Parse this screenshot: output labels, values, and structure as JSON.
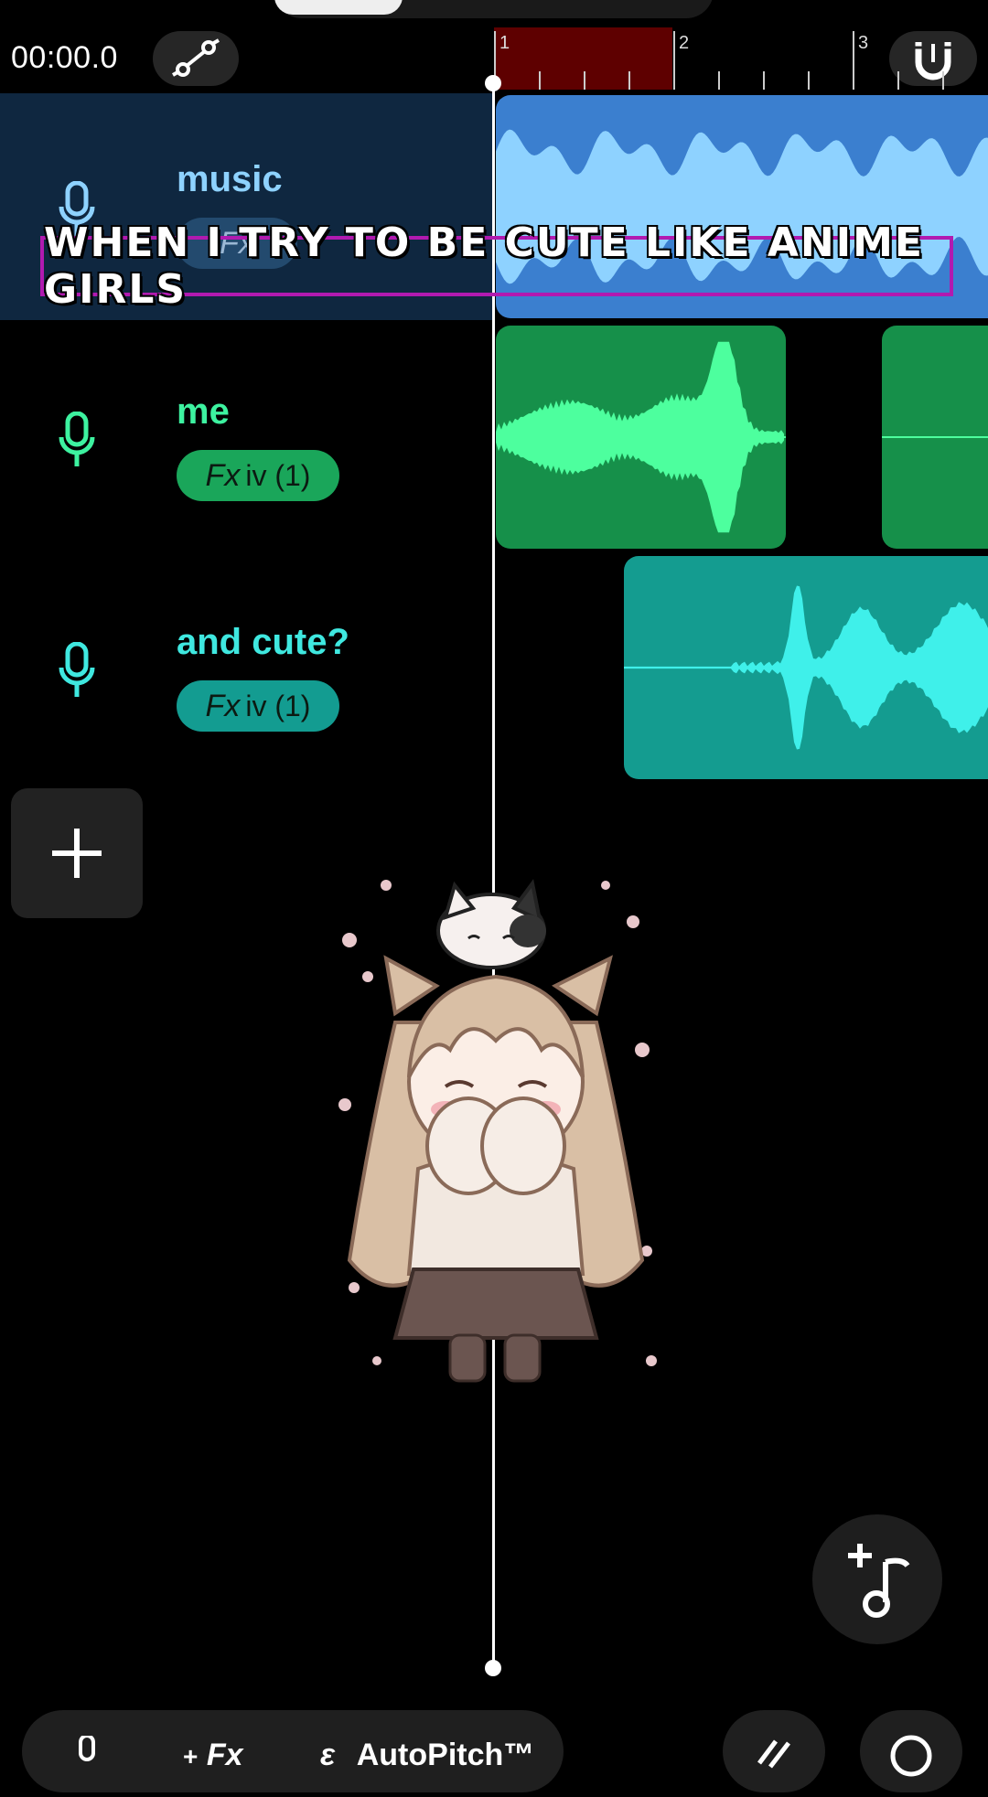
{
  "header": {
    "time": "00:00.0",
    "bar_numbers": [
      "1",
      "2",
      "3"
    ]
  },
  "tracks": [
    {
      "name": "music",
      "fx_label": "Fx",
      "fx_preset": "",
      "color": "#3b7fcf",
      "wave_color": "#8ed2ff",
      "selected": true
    },
    {
      "name": "me",
      "fx_label": "Fx",
      "fx_preset": "iv (1)",
      "color": "#16904a",
      "wave_color": "#4dff9e",
      "name_color": "#3df2a0",
      "pill_color": "#1aa65a"
    },
    {
      "name": "and cute?",
      "fx_label": "Fx",
      "fx_preset": "iv (1)",
      "color": "#149c90",
      "wave_color": "#3ff0ea",
      "name_color": "#3fe8e0",
      "pill_color": "#139c91"
    }
  ],
  "caption": {
    "text": "WHEN I TRY TO BE CUTE LIKE ANIME GIRLS"
  },
  "bottom": {
    "fx_label": "Fx",
    "autopitch_label": "AutoPitch™"
  },
  "colors": {
    "loop_region": "#5e0000",
    "caption_border": "#b11ab0",
    "selected_track_bg": "#0f2740"
  }
}
